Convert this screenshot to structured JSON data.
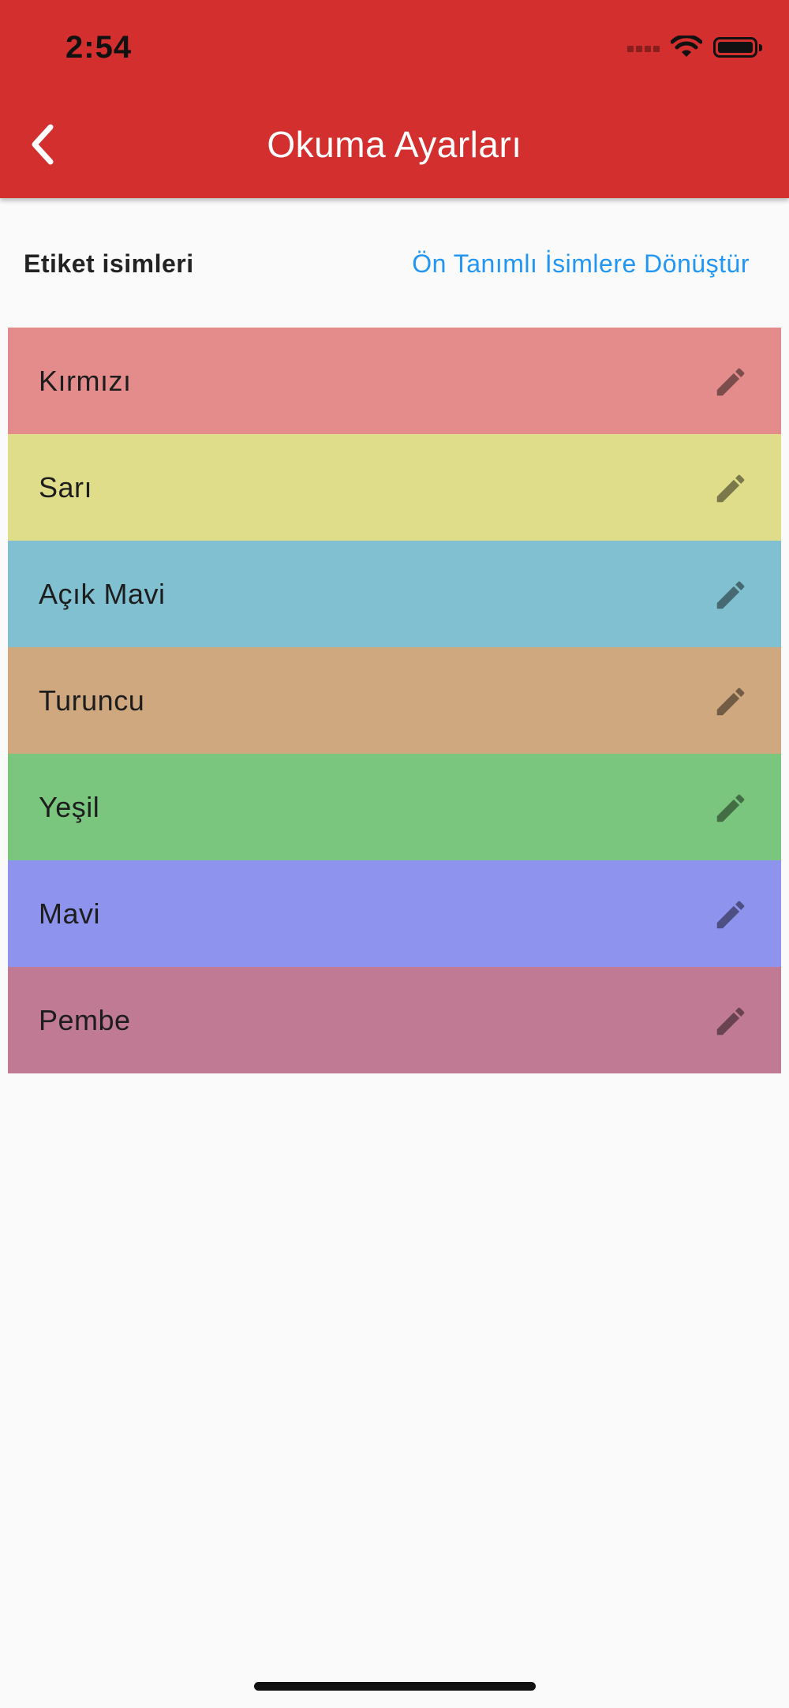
{
  "status_bar": {
    "time": "2:54",
    "icons": [
      "signal-icon",
      "wifi-icon",
      "battery-icon"
    ]
  },
  "header": {
    "title": "Okuma Ayarları",
    "back_icon": "chevron-left-icon",
    "background_color": "#d32f2f"
  },
  "section": {
    "title": "Etiket isimleri",
    "reset_action": "Ön Tanımlı İsimlere Dönüştür",
    "reset_action_color": "#2196f3"
  },
  "labels": [
    {
      "name": "Kırmızı",
      "color": "#e48c8c",
      "icon": "pencil-icon"
    },
    {
      "name": "Sarı",
      "color": "#e0dd8a",
      "icon": "pencil-icon"
    },
    {
      "name": "Açık Mavi",
      "color": "#80c0d0",
      "icon": "pencil-icon"
    },
    {
      "name": "Turuncu",
      "color": "#cfa87f",
      "icon": "pencil-icon"
    },
    {
      "name": "Yeşil",
      "color": "#7bc67f",
      "icon": "pencil-icon"
    },
    {
      "name": "Mavi",
      "color": "#8e93ee",
      "icon": "pencil-icon"
    },
    {
      "name": "Pembe",
      "color": "#c07a93",
      "icon": "pencil-icon"
    }
  ]
}
